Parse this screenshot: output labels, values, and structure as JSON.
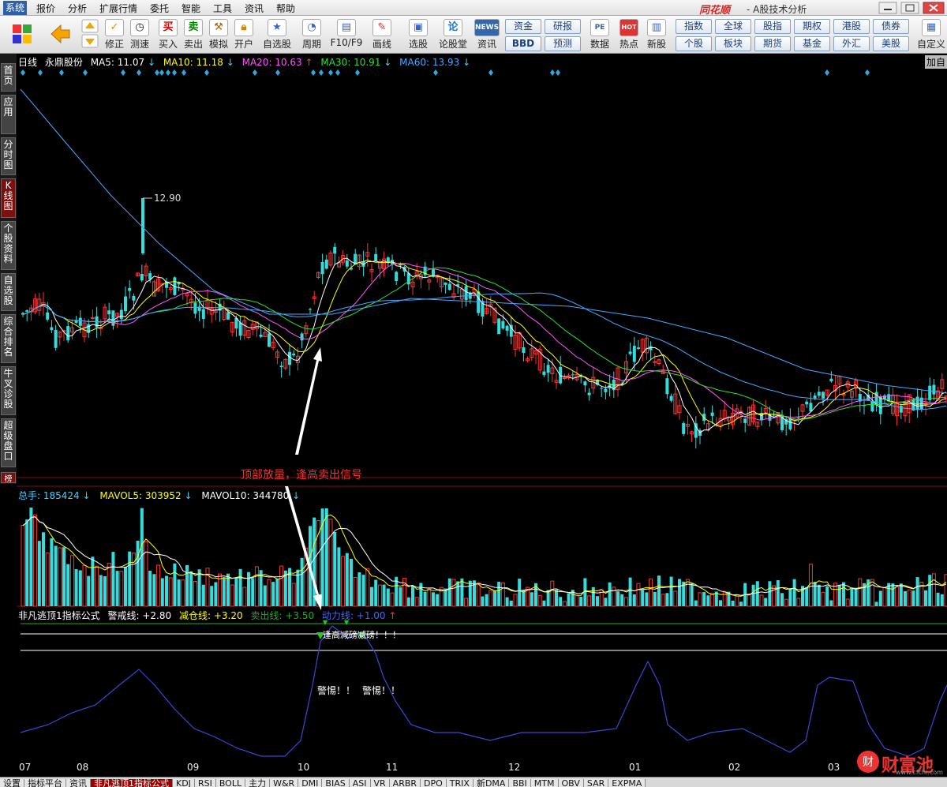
{
  "menu": [
    "系统",
    "报价",
    "分析",
    "扩展行情",
    "委托",
    "智能",
    "工具",
    "资讯",
    "帮助"
  ],
  "brand": {
    "name": "同花顺",
    "sub": "- A股技术分析"
  },
  "toolbar": {
    "left": [
      {
        "label": "",
        "icon": "grid-icon"
      },
      {
        "label": "",
        "icon": "back-arrow-icon"
      },
      {
        "label": "",
        "icon": "up-down-arrow-icon"
      },
      {
        "label": "修正",
        "icon": "correct-icon"
      },
      {
        "label": "测速",
        "icon": "clock-icon"
      },
      {
        "label": "买入",
        "icon": "buy-icon",
        "glyph": "买"
      },
      {
        "label": "卖出",
        "icon": "sell-icon",
        "glyph": "卖"
      },
      {
        "label": "模拟",
        "icon": "hammer-icon"
      },
      {
        "label": "开户",
        "icon": "lock-icon"
      },
      {
        "label": "自选股",
        "icon": "star-icon"
      },
      {
        "label": "周期",
        "icon": "clock-cycle-icon"
      },
      {
        "label": "F10/F9",
        "icon": "f10-icon"
      },
      {
        "label": "画线",
        "icon": "pen-icon"
      },
      {
        "label": "选股",
        "icon": "monitor-icon"
      },
      {
        "label": "论股堂",
        "icon": "lungutang-icon",
        "glyph": "论"
      },
      {
        "label": "资讯",
        "icon": "news-icon",
        "glyph": "NEWS"
      },
      {
        "label": "数据",
        "icon": "pe-icon",
        "glyph": "PE"
      },
      {
        "label": "热点",
        "icon": "hot-icon",
        "glyph": "HOT"
      },
      {
        "label": "新股",
        "icon": "new-stock-icon"
      },
      {
        "label": "自定义",
        "icon": "custom-icon"
      }
    ],
    "grid1": [
      [
        "资金",
        "研报"
      ],
      [
        "BBD",
        "预测"
      ]
    ],
    "grid2": [
      [
        "指数",
        "全球",
        "股指",
        "期权",
        "港股",
        "债券"
      ],
      [
        "个股",
        "板块",
        "期货",
        "基金",
        "外汇",
        "美股"
      ]
    ]
  },
  "sidebar": [
    "首页",
    "应用",
    "分时图",
    "K线图",
    "个股资料",
    "自选股",
    "综合排名",
    "牛叉诊股",
    "超级盘口"
  ],
  "kline": {
    "period": "日线",
    "stock": "永鼎股份",
    "ma": [
      {
        "name": "MA5",
        "value": "11.07",
        "dir": "↓",
        "color": "#ffffff"
      },
      {
        "name": "MA10",
        "value": "11.18",
        "dir": "↓",
        "color": "#ffff00"
      },
      {
        "name": "MA20",
        "value": "10.63",
        "dir": "↑",
        "color": "#ff55ff"
      },
      {
        "name": "MA30",
        "value": "10.91",
        "dir": "↓",
        "color": "#33dd33"
      },
      {
        "name": "MA60",
        "value": "13.93",
        "dir": "↓",
        "color": "#44aaff"
      }
    ],
    "high_label": "12.90",
    "right_label": "加自"
  },
  "annotation": "顶部放量，逢高卖出信号",
  "bang": "榜",
  "volume": {
    "items": [
      {
        "name": "总手",
        "value": "185424",
        "dir": "↓",
        "color": "#44ccff"
      },
      {
        "name": "MAVOL5",
        "value": "303952",
        "dir": "↓",
        "color": "#ffff00"
      },
      {
        "name": "MAVOL10",
        "value": "344780",
        "dir": "↓",
        "color": "#ffffff"
      }
    ]
  },
  "indicator": {
    "title": "非凡逃顶1指标公式",
    "items": [
      {
        "name": "警戒线",
        "value": "+2.80",
        "color": "#ffffff"
      },
      {
        "name": "减仓线",
        "value": "+3.20",
        "color": "#ffff00"
      },
      {
        "name": "卖出线",
        "value": "+3.50",
        "color": "#22aa22"
      },
      {
        "name": "动力线",
        "value": "+1.00",
        "color": "#4466ff",
        "dir": "↑"
      }
    ],
    "signal_top": "逢高减磅减磅！！！",
    "signal_warn": [
      "警惕！！",
      "警惕！！"
    ]
  },
  "xaxis": [
    "07",
    "08",
    "09",
    "10",
    "11",
    "12",
    "01",
    "02",
    "03"
  ],
  "bottom_tabs": [
    "设置",
    "指标平台",
    "资讯",
    "非凡逃顶1指标公式",
    "KDJ",
    "RSI",
    "BOLL",
    "主力",
    "W&R",
    "DMI",
    "BIAS",
    "ASI",
    "VR",
    "ARBR",
    "DPO",
    "TRIX",
    "新DMA",
    "BBI",
    "MTM",
    "OBV",
    "SAR",
    "EXPMA"
  ],
  "watermark": {
    "text": "财富池",
    "sub": "www.cfchi.com"
  }
}
